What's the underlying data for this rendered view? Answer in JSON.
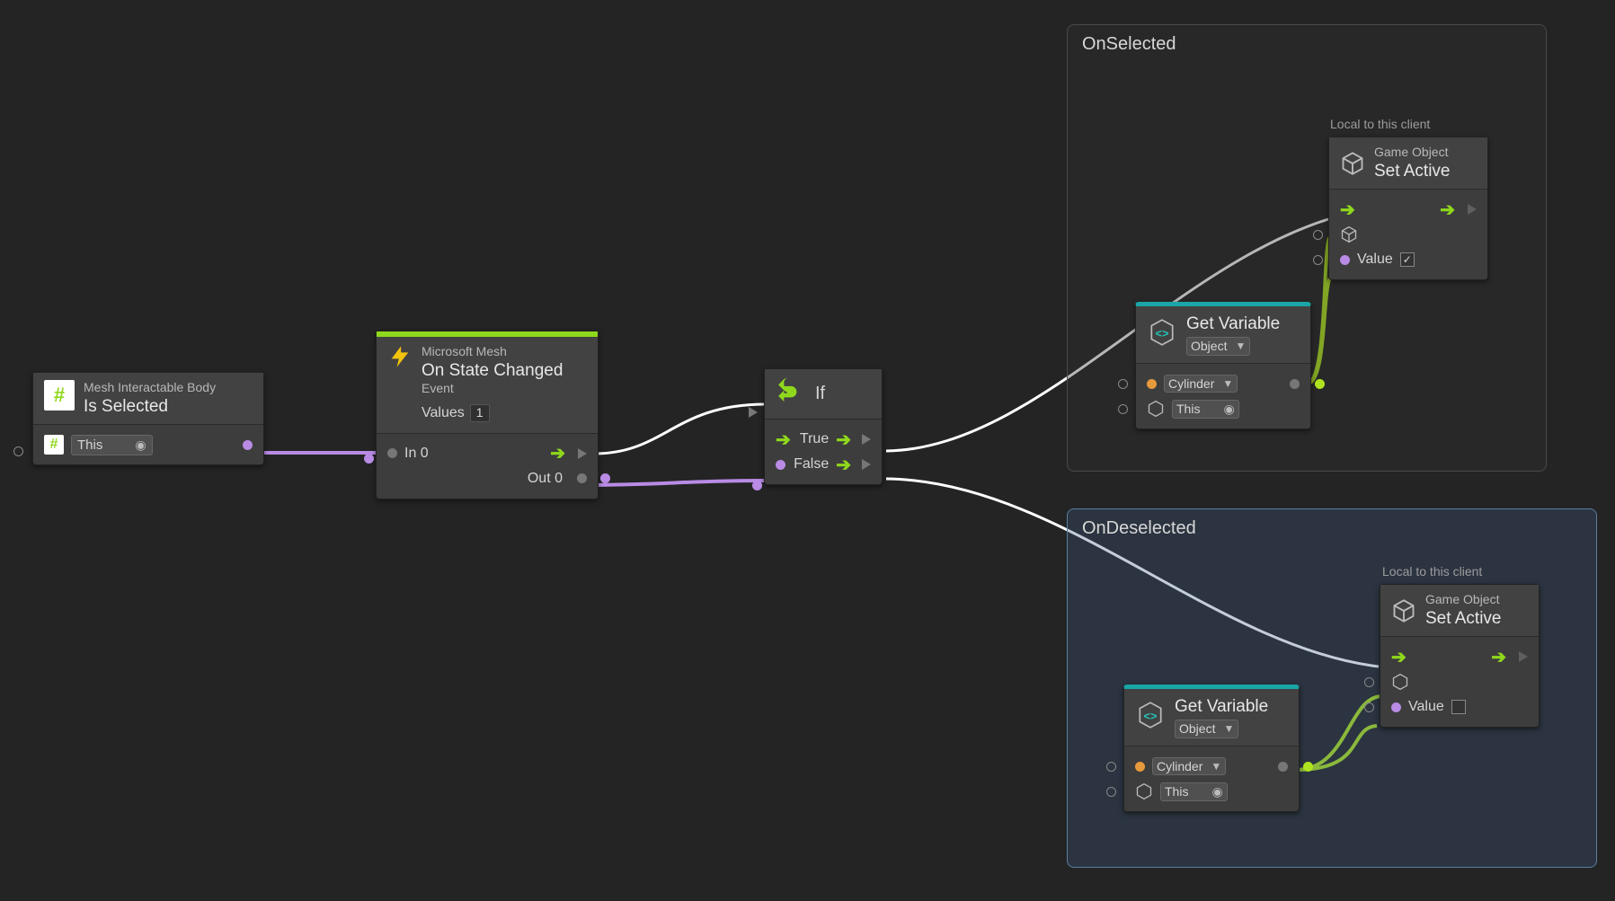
{
  "node_isSelected": {
    "category": "Mesh Interactable Body",
    "title": "Is Selected",
    "target_value": "This"
  },
  "node_onStateChanged": {
    "category": "Microsoft Mesh",
    "title": "On State Changed",
    "subtitle": "Event",
    "values_label": "Values",
    "values_count": "1",
    "in_label": "In 0",
    "out_label": "Out 0"
  },
  "node_if": {
    "title": "If",
    "true_label": "True",
    "false_label": "False"
  },
  "group_onSelected": {
    "title": "OnSelected",
    "scope_note": "Local to this client"
  },
  "group_onDeselected": {
    "title": "OnDeselected",
    "scope_note": "Local to this client"
  },
  "node_getVariable": {
    "title": "Get Variable",
    "scope": "Object",
    "var_name": "Cylinder",
    "target": "This"
  },
  "node_setActive": {
    "category": "Game Object",
    "title": "Set Active",
    "value_label": "Value"
  },
  "checkbox_on": "✓",
  "checkbox_off": ""
}
